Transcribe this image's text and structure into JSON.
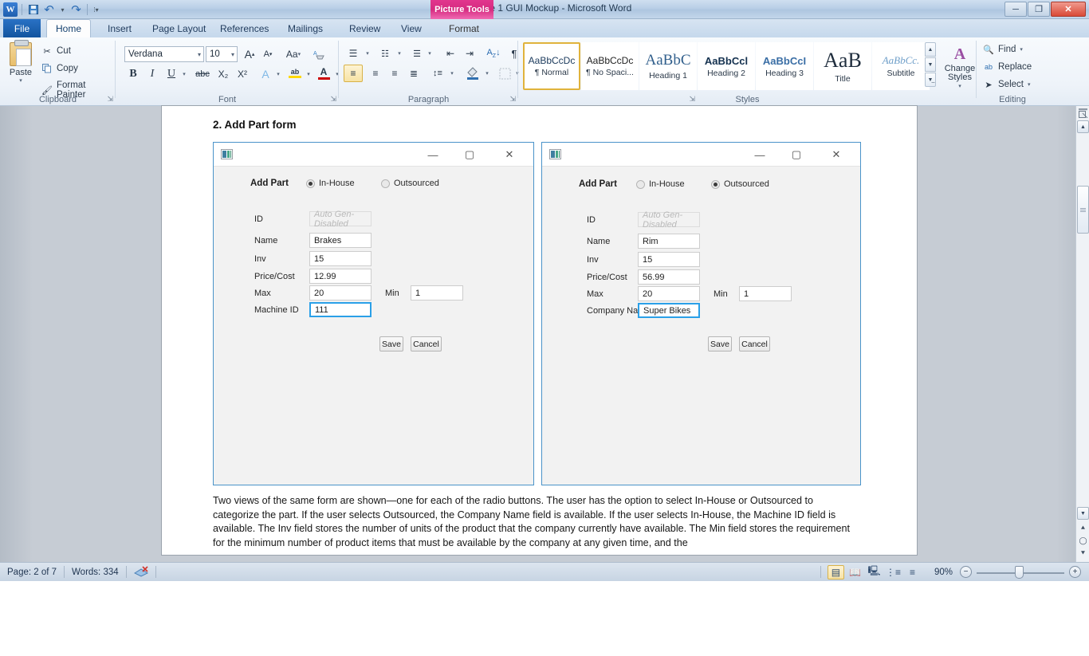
{
  "window": {
    "title": "Software 1 GUI Mockup  -  Microsoft Word",
    "contextual_tab_group": "Picture Tools",
    "quick_access": [
      {
        "name": "save",
        "glyph": "💾"
      },
      {
        "name": "undo",
        "glyph": "↶"
      },
      {
        "name": "redo",
        "glyph": "↷"
      }
    ],
    "controls": {
      "minimize": "─",
      "restore": "❐",
      "close": "✕"
    },
    "help": "?",
    "collapse_ribbon": "⌃"
  },
  "tabs": [
    {
      "label": "File",
      "state": "file"
    },
    {
      "label": "Home",
      "state": "active"
    },
    {
      "label": "Insert",
      "state": "normal"
    },
    {
      "label": "Page Layout",
      "state": "normal"
    },
    {
      "label": "References",
      "state": "normal"
    },
    {
      "label": "Mailings",
      "state": "normal"
    },
    {
      "label": "Review",
      "state": "normal"
    },
    {
      "label": "View",
      "state": "normal"
    },
    {
      "label": "Format",
      "state": "contextual"
    }
  ],
  "ribbon": {
    "groups": [
      {
        "label": "Clipboard"
      },
      {
        "label": "Font"
      },
      {
        "label": "Paragraph"
      },
      {
        "label": "Styles"
      },
      {
        "label": "Editing"
      }
    ],
    "clipboard": {
      "paste_label": "Paste",
      "cut_label": "Cut",
      "copy_label": "Copy",
      "format_painter_label": "Format Painter"
    },
    "font": {
      "font_name": "Verdana",
      "font_size": "10",
      "grow_font": "A",
      "shrink_font": "A",
      "change_case": "Aa",
      "clear_formatting": "A",
      "bold": "B",
      "italic": "I",
      "underline": "U",
      "strikethrough": "abc",
      "subscript": "X₂",
      "superscript": "X²",
      "text_effects": "A",
      "highlight": "ab",
      "font_color": "A"
    },
    "styles": [
      {
        "preview": "AaBbCcDc",
        "name": "¶ Normal",
        "selected": true
      },
      {
        "preview": "AaBbCcDc",
        "name": "¶ No Spaci...",
        "selected": false
      },
      {
        "preview": "AaBbC",
        "name": "Heading 1",
        "selected": false
      },
      {
        "preview": "AaBbCcl",
        "name": "Heading 2",
        "selected": false
      },
      {
        "preview": "AaBbCcI",
        "name": "Heading 3",
        "selected": false
      },
      {
        "preview": "AaB",
        "name": "Title",
        "selected": false
      },
      {
        "preview": "AaBbCc.",
        "name": "Subtitle",
        "selected": false
      }
    ],
    "change_styles_label": "Change\nStyles",
    "editing": {
      "find_label": "Find",
      "replace_label": "Replace",
      "select_label": "Select"
    }
  },
  "document": {
    "heading": "2. Add Part form",
    "paragraph": "Two views of the same form are shown—one for each of the radio buttons. The user has the option to select In-House or Outsourced to categorize the part. If the user selects Outsourced, the Company Name field is available. If the user selects In-House, the Machine ID field is available. The Inv field stores the number of units of the product that the company currently have available. The Min field stores the requirement for the minimum number of product items that must be available by the company at any given time, and the"
  },
  "forms": {
    "left": {
      "legend": "Add Part",
      "radios": [
        {
          "label": "In-House",
          "selected": true
        },
        {
          "label": "Outsourced",
          "selected": false
        }
      ],
      "fields": [
        {
          "label": "ID",
          "value": "Auto Gen- Disabled",
          "state": "disabled"
        },
        {
          "label": "Name",
          "value": "Brakes",
          "state": "normal"
        },
        {
          "label": "Inv",
          "value": "15",
          "state": "normal"
        },
        {
          "label": "Price/Cost",
          "value": "12.99",
          "state": "normal"
        },
        {
          "label": "Max",
          "value": "20",
          "state": "normal"
        },
        {
          "label": "Machine ID",
          "value": "111",
          "state": "focused"
        }
      ],
      "min_label": "Min",
      "min_value": "1",
      "save_label": "Save",
      "cancel_label": "Cancel"
    },
    "right": {
      "legend": "Add Part",
      "radios": [
        {
          "label": "In-House",
          "selected": false
        },
        {
          "label": "Outsourced",
          "selected": true
        }
      ],
      "fields": [
        {
          "label": "ID",
          "value": "Auto Gen- Disabled",
          "state": "disabled"
        },
        {
          "label": "Name",
          "value": "Rim",
          "state": "normal"
        },
        {
          "label": "Inv",
          "value": "15",
          "state": "normal"
        },
        {
          "label": "Price/Cost",
          "value": "56.99",
          "state": "normal"
        },
        {
          "label": "Max",
          "value": "20",
          "state": "normal"
        },
        {
          "label": "Company Name",
          "value": "Super Bikes",
          "state": "focused"
        }
      ],
      "min_label": "Min",
      "min_value": "1",
      "save_label": "Save",
      "cancel_label": "Cancel"
    }
  },
  "statusbar": {
    "page": "Page: 2 of 7",
    "words": "Words: 334",
    "proofing_icon": "proofing-errors-icon",
    "zoom_level": "90%",
    "zoom_out": "−",
    "zoom_in": "+",
    "views": [
      {
        "name": "print-layout",
        "selected": true
      },
      {
        "name": "full-screen-reading",
        "selected": false
      },
      {
        "name": "web-layout",
        "selected": false
      },
      {
        "name": "outline",
        "selected": false
      },
      {
        "name": "draft",
        "selected": false
      }
    ]
  },
  "colors": {
    "accent_blue": "#4a93c9",
    "focus_blue": "#2aa0e8",
    "contextual_pink": "#e2368e",
    "file_tab_blue": "#13549f"
  }
}
